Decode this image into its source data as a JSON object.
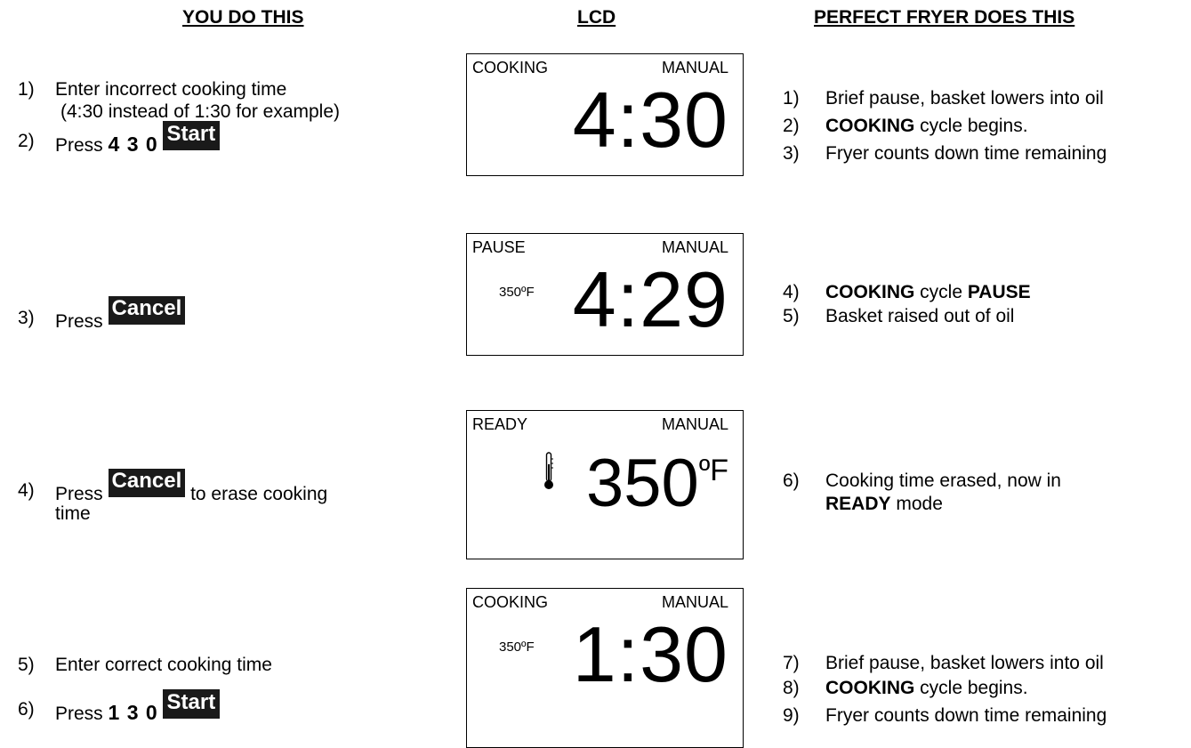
{
  "headers": {
    "you": "YOU DO THIS",
    "lcd": "LCD",
    "fryer": "PERFECT FRYER DOES THIS"
  },
  "steps": [
    {
      "n": "1)",
      "text": "Enter incorrect cooking time",
      "sub": "(4:30 instead of 1:30 for example)"
    },
    {
      "n": "2)",
      "press": "Press",
      "digits": "4 3 0",
      "key": "Start"
    },
    {
      "n": "3)",
      "press": "Press",
      "key": "Cancel"
    },
    {
      "n": "4)",
      "press": "Press",
      "key": "Cancel",
      "after": "to erase cooking",
      "after2": "time"
    },
    {
      "n": "5)",
      "text": "Enter correct cooking time"
    },
    {
      "n": "6)",
      "press": "Press",
      "digits": "1 3 0",
      "key": "Start"
    }
  ],
  "lcds": [
    {
      "status": "COOKING",
      "mode": "MANUAL",
      "time": "4:30",
      "temp": ""
    },
    {
      "status": "PAUSE",
      "mode": "MANUAL",
      "time": "4:29",
      "temp": "350ºF"
    },
    {
      "status": "READY",
      "mode": "MANUAL",
      "bigtemp": "350",
      "unit": "ºF",
      "icon": "thermometer-icon"
    },
    {
      "status": "COOKING",
      "mode": "MANUAL",
      "time": "1:30",
      "temp": "350ºF"
    }
  ],
  "fryer": [
    {
      "n": "1)",
      "text": "Brief pause, basket lowers into oil"
    },
    {
      "n": "2)",
      "bold": "COOKING",
      "text": " cycle begins."
    },
    {
      "n": "3)",
      "text": "Fryer counts down time remaining"
    },
    {
      "n": "4)",
      "bold": "COOKING",
      "text": " cycle ",
      "bold2": "PAUSE"
    },
    {
      "n": "5)",
      "text": "Basket raised out of oil"
    },
    {
      "n": "6)",
      "text": "Cooking time erased, now in",
      "bold": "READY",
      "text2": " mode"
    },
    {
      "n": "7)",
      "text": "Brief pause, basket lowers into oil"
    },
    {
      "n": "8)",
      "bold": "COOKING",
      "text": " cycle begins."
    },
    {
      "n": "9)",
      "text": "Fryer counts down time remaining"
    }
  ]
}
